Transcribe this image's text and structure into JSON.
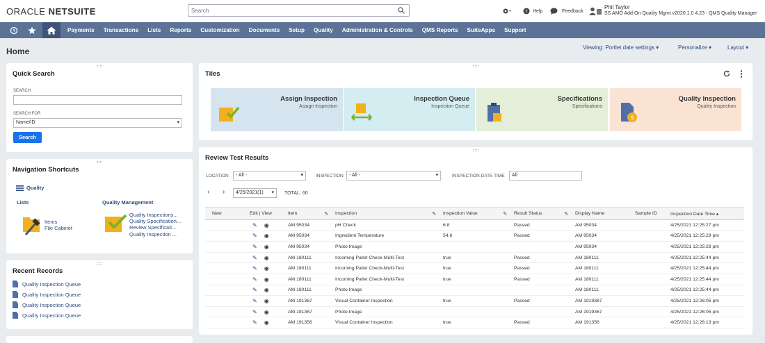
{
  "brand": {
    "oracle": "ORACLE",
    "netsuite": "NETSUITE"
  },
  "search": {
    "placeholder": "Search"
  },
  "header": {
    "help": "Help",
    "feedback": "Feedback",
    "user_name": "Phil Taylor",
    "user_role": "SS AMO Add-On Quality Mgmt v2020.1.0 4.23 - QMS Quality Manager"
  },
  "nav": {
    "items": [
      "Payments",
      "Transactions",
      "Lists",
      "Reports",
      "Customization",
      "Documents",
      "Setup",
      "Quality",
      "Administration & Controls",
      "QMS Reports",
      "SuiteApps",
      "Support"
    ]
  },
  "page": {
    "title": "Home",
    "viewing": "Viewing: Portlet date settings",
    "personalize": "Personalize",
    "layout": "Layout"
  },
  "quick_search": {
    "title": "Quick Search",
    "search_label": "SEARCH",
    "search_for_label": "SEARCH FOR",
    "search_for_value": "Name/ID",
    "button": "Search"
  },
  "nav_shortcuts": {
    "title": "Navigation Shortcuts",
    "group": "Quality",
    "lists_title": "Lists",
    "lists_items": [
      "Items",
      "File Cabinet"
    ],
    "qm_title": "Quality Management",
    "qm_items": [
      "Quality Inspections...",
      "Quality Specification...",
      "Review Specificati...",
      "Quality Inspection ..."
    ]
  },
  "recent": {
    "title": "Recent Records",
    "items": [
      "Quality Inspection Queue",
      "Quality Inspection Queue",
      "Quality Inspection Queue",
      "Quality Inspection Queue"
    ]
  },
  "tiles": {
    "title": "Tiles",
    "items": [
      {
        "title": "Assign Inspection",
        "sub": "Assign Inspection",
        "color": "#d6e4f0"
      },
      {
        "title": "Inspection Queue",
        "sub": "Inspection Queue",
        "color": "#d4edf0"
      },
      {
        "title": "Specifications",
        "sub": "Specifications",
        "color": "#e3efd8"
      },
      {
        "title": "Quality Inspection",
        "sub": "Quality Inspection",
        "color": "#fbe3d4"
      }
    ]
  },
  "review": {
    "title": "Review Test Results",
    "location_label": "LOCATION",
    "location_value": "- All -",
    "inspection_label": "INSPECTION",
    "inspection_value": "- All -",
    "date_label": "INSPECTION DATE TIME",
    "date_value": "All",
    "period": "4/25/2021(1)",
    "total_label": "TOTAL:",
    "total_value": "66",
    "columns": [
      "New",
      "Edit | View",
      "Item",
      "Inspection",
      "Inspection Value",
      "Result Status",
      "Display Name",
      "Sample ID",
      "Inspection Date Time ▴"
    ],
    "rows": [
      [
        "AM 95034",
        "pH Check",
        "6.8",
        "Passed",
        "AM 95034",
        "",
        "4/25/2021 12:25:27 pm"
      ],
      [
        "AM 95034",
        "Ingredient Temperature",
        "54.6",
        "Passed",
        "AM 95034",
        "",
        "4/25/2021 12:25:28 pm"
      ],
      [
        "AM 95034",
        "Photo Image",
        "",
        "",
        "AM 95034",
        "",
        "4/25/2021 12:25:28 pm"
      ],
      [
        "AM 180111",
        "Incoming Pallet Check-Multi-Test",
        "true",
        "Passed",
        "AM 180111",
        "",
        "4/25/2021 12:25:44 pm"
      ],
      [
        "AM 180111",
        "Incoming Pallet Check-Multi-Test",
        "true",
        "Passed",
        "AM 180111",
        "",
        "4/25/2021 12:25:44 pm"
      ],
      [
        "AM 180111",
        "Incoming Pallet Check-Multi-Test",
        "true",
        "Passed",
        "AM 180111",
        "",
        "4/25/2021 12:25:44 pm"
      ],
      [
        "AM 180111",
        "Photo Image",
        "",
        "",
        "AM 180111",
        "",
        "4/25/2021 12:25:44 pm"
      ],
      [
        "AM 191367",
        "Visual Container Inspection",
        "true",
        "Passed",
        "AM 1919367",
        "",
        "4/25/2021 12:26:05 pm"
      ],
      [
        "AM 191367",
        "Photo Image",
        "",
        "",
        "AM 1919367",
        "",
        "4/25/2021 12:26:05 pm"
      ],
      [
        "AM 191356",
        "Visual Container Inspection",
        "true",
        "Passed",
        "AM 191356",
        "",
        "4/25/2021 12:26:13 pm"
      ]
    ]
  }
}
